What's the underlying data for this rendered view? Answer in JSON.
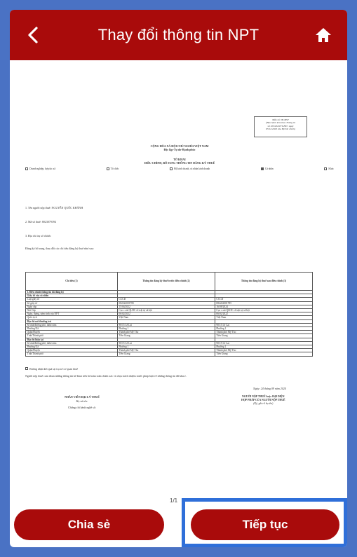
{
  "header": {
    "title": "Thay đổi thông tin NPT",
    "back_icon": "chevron-left-icon",
    "home_icon": "home-icon"
  },
  "document": {
    "form_box": {
      "line1": "Mẫu số: 08-MST",
      "line2": "(Ban hành kèm theo Thông tư",
      "line3": "số 105/2020/TT-BTC ngày",
      "line4": "03/12/2020 của Bộ Tài chính)"
    },
    "national_title": "CỘNG HÒA XÃ HỘI CHỦ NGHĨA VIỆT NAM",
    "motto": "Độc lập-Tự do-Hạnh phúc",
    "doc_title": "TỜ KHAI",
    "doc_subtitle": "ĐIỀU CHỈNH, BỔ SUNG THÔNG TIN ĐĂNG KÝ THUẾ",
    "checkboxes": [
      "Doanh nghiệp, hợp tác xã",
      "Tổ chức",
      "Hộ kinh doanh, cá nhân kinh doanh",
      "Cá nhân",
      "Khác"
    ],
    "field1": "1. Tên người nộp thuế: NGUYỄN QUỐC KHÁNH",
    "field2": "2. Mã số thuế: 8023079394",
    "field3": "3. Địa chỉ trụ sở chính:",
    "intro": "Đăng ký bổ sung, thay đổi các chỉ tiêu đăng ký thuế như sau:",
    "table": {
      "headers": [
        "Chỉ tiêu (1)",
        "Thông tin đăng ký thuế trước điều chỉnh (2)",
        "Thông tin đăng ký thuế sau điều chỉnh (3)"
      ],
      "rows": [
        [
          "I. Điều chỉnh thông tin đã đăng ký",
          "",
          ""
        ],
        [
          "Giấy tờ của cá nhân",
          "",
          ""
        ],
        [
          "Loại giấy tờ",
          "CCCD",
          "CCCD"
        ],
        [
          "Số giấy tờ",
          "082222001785",
          "082222001785"
        ],
        [
          "Ngày cấp",
          "15/04/2022",
          "16/08/2024"
        ],
        [
          "Nơi Cấp",
          "Cục c.sát QLHC về trật tự xã hội",
          "Cục c.sát QLHC về trật tự xã hội"
        ],
        [
          "Ngày, tháng, năm sinh của NPT",
          "06/02/2022",
          "06/02/2022"
        ],
        [
          "Quốc tịch",
          "Việt Nam",
          "Việt Nam"
        ],
        [
          "Địa chỉ nơi thường trú",
          "",
          ""
        ],
        [
          "Số nhà/đường phố, thôn/xóm",
          "90/15 Lê Lai",
          "90/15 Lê Lai"
        ],
        [
          "Phường/Xã",
          "Phường 1",
          "Phường 1"
        ],
        [
          "Quận/Huyện",
          "Thành phố Mỹ Tho",
          "Thành phố Mỹ Tho"
        ],
        [
          "Tỉnh/Thành phố",
          "Tiền Giang",
          "Tiền Giang"
        ],
        [
          "Địa chỉ hiện tại",
          "",
          ""
        ],
        [
          "Số nhà/đường phố, thôn/xóm",
          "90/15 Lê Lai",
          "90/15 Lê Lai"
        ],
        [
          "Phường/Xã",
          "Phường 1",
          "Phường 1"
        ],
        [
          "Quận/Huyện",
          "Thành phố Mỹ Tho",
          "Thành phố Mỹ Tho"
        ],
        [
          "Tỉnh/Thành phố",
          "Tiền Giang",
          "Tiền Giang"
        ]
      ]
    },
    "confirm_check": "Không nhận kết quả tại trụ sở cơ quan thuế",
    "declaration": "Người nộp thuế cam đoan những thông tin kê khai trên là hoàn toàn chính xác và chịu trách nhiệm trước pháp luật về những thông tin đã khai./.",
    "date_line": "Ngày: 24 tháng 09 năm 2024",
    "sig_left_title": "NHÂN VIÊN ĐẠI LÝ THUẾ",
    "sig_left_name": "Họ và tên:",
    "sig_left_cert": "Chứng chỉ hành nghề số:",
    "sig_right_title1": "NGƯỜI NỘP THUẾ hoặc ĐẠI DIỆN",
    "sig_right_title2": "HỢP PHÁP CỦA NGƯỜI NỘP THUẾ",
    "sig_right_note": "(Ký, ghi rõ họ tên)"
  },
  "page_indicator": "1/1",
  "footer": {
    "share_label": "Chia sẻ",
    "next_label": "Tiếp tục"
  },
  "colors": {
    "brand": "#a90b0b",
    "background": "#4a72c4",
    "highlight": "#2f6fd9"
  }
}
